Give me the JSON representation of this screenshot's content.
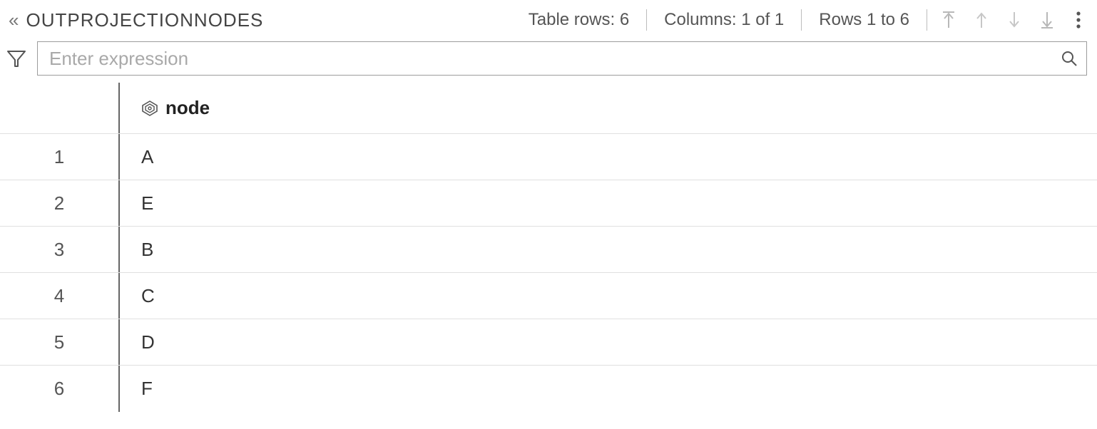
{
  "header": {
    "title": "OUTPROJECTIONNODES",
    "table_rows": "Table rows: 6",
    "columns": "Columns: 1 of 1",
    "rows_range": "Rows 1 to 6"
  },
  "filter": {
    "placeholder": "Enter expression"
  },
  "table": {
    "column_header": "node",
    "rows": [
      {
        "index": "1",
        "value": "A"
      },
      {
        "index": "2",
        "value": "E"
      },
      {
        "index": "3",
        "value": "B"
      },
      {
        "index": "4",
        "value": "C"
      },
      {
        "index": "5",
        "value": "D"
      },
      {
        "index": "6",
        "value": "F"
      }
    ]
  }
}
